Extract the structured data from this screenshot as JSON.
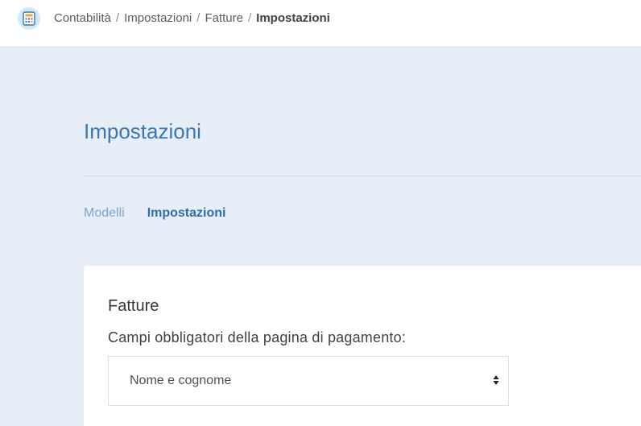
{
  "breadcrumb": {
    "items": [
      "Contabilità",
      "Impostazioni",
      "Fatture"
    ],
    "current": "Impostazioni",
    "separator": "/"
  },
  "page": {
    "title": "Impostazioni",
    "tabs": [
      {
        "label": "Modelli",
        "active": false
      },
      {
        "label": "Impostazioni",
        "active": true
      }
    ]
  },
  "card": {
    "title": "Fatture",
    "field_label": "Campi obbligatori della pagina di pagamento:",
    "select_value": "Nome e cognome"
  },
  "icons": {
    "app": "accounting-calculator-icon",
    "select": "sort-arrows-icon"
  },
  "colors": {
    "accent": "#3a78b5",
    "background": "#e7eef8"
  }
}
